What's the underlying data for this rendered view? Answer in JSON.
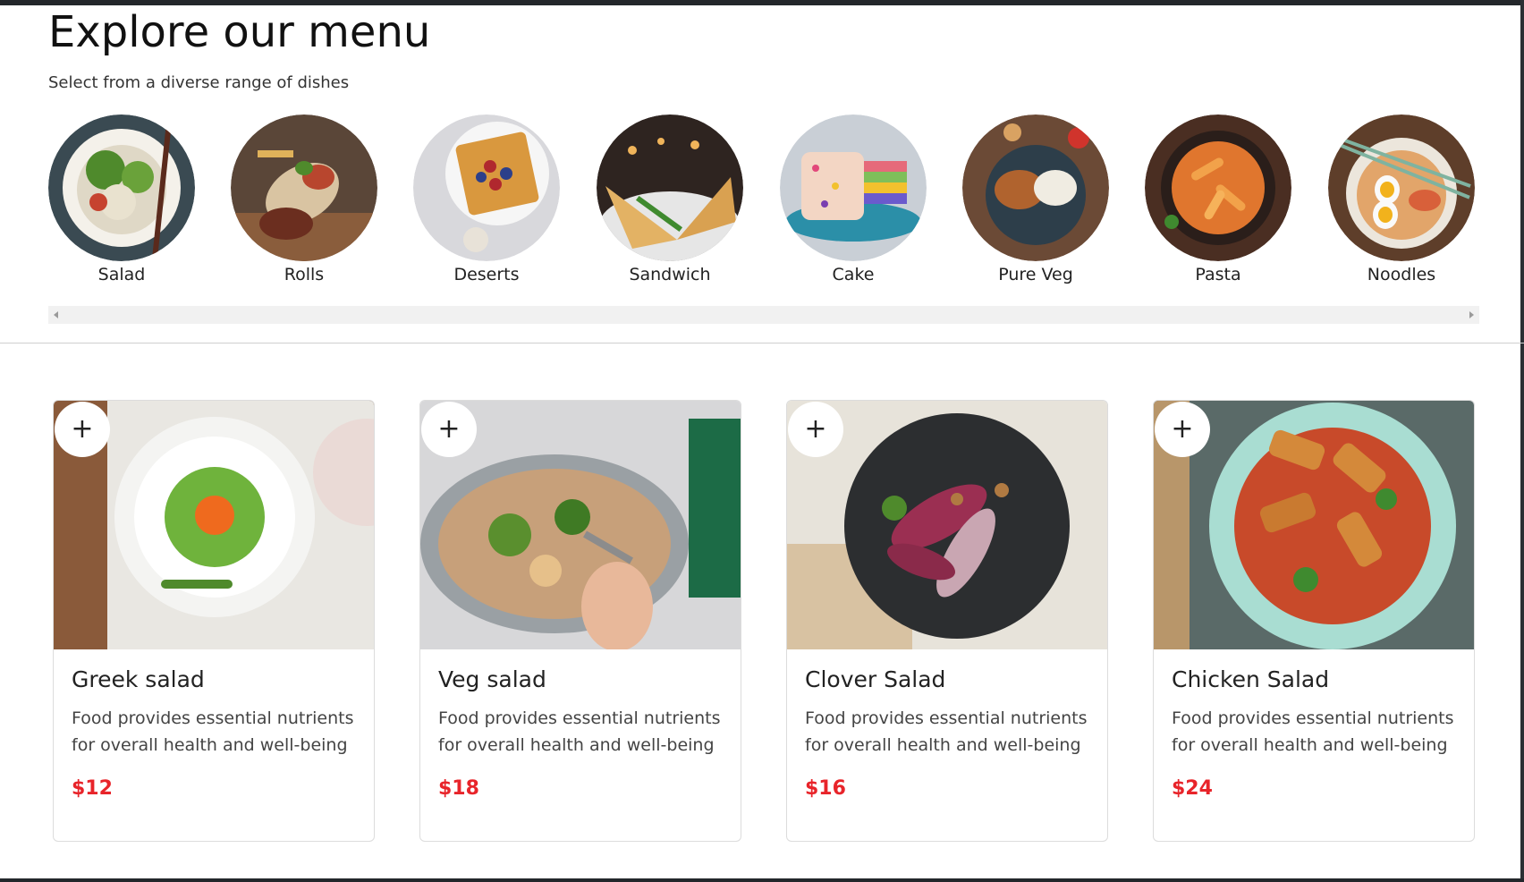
{
  "header": {
    "title": "Explore our menu",
    "subtitle": "Select from a diverse range of dishes"
  },
  "categories": [
    {
      "label": "Salad",
      "icon": "salad-bowl-photo"
    },
    {
      "label": "Rolls",
      "icon": "rolls-photo"
    },
    {
      "label": "Deserts",
      "icon": "waffle-photo"
    },
    {
      "label": "Sandwich",
      "icon": "sandwich-photo"
    },
    {
      "label": "Cake",
      "icon": "cake-photo"
    },
    {
      "label": "Pure Veg",
      "icon": "pure-veg-photo"
    },
    {
      "label": "Pasta",
      "icon": "pasta-photo"
    },
    {
      "label": "Noodles",
      "icon": "noodles-photo"
    }
  ],
  "food_items": [
    {
      "name": "Greek salad",
      "description": "Food provides essential nutrients for overall health and well-being",
      "price": "$12",
      "add_label": "+"
    },
    {
      "name": "Veg salad",
      "description": "Food provides essential nutrients for overall health and well-being",
      "price": "$18",
      "add_label": "+"
    },
    {
      "name": "Clover Salad",
      "description": "Food provides essential nutrients for overall health and well-being",
      "price": "$16",
      "add_label": "+"
    },
    {
      "name": "Chicken Salad",
      "description": "Food provides essential nutrients for overall health and well-being",
      "price": "$24",
      "add_label": "+"
    }
  ],
  "colors": {
    "price": "#e8242a",
    "top_bar": "#23272b",
    "divider": "#cfcfcf"
  }
}
